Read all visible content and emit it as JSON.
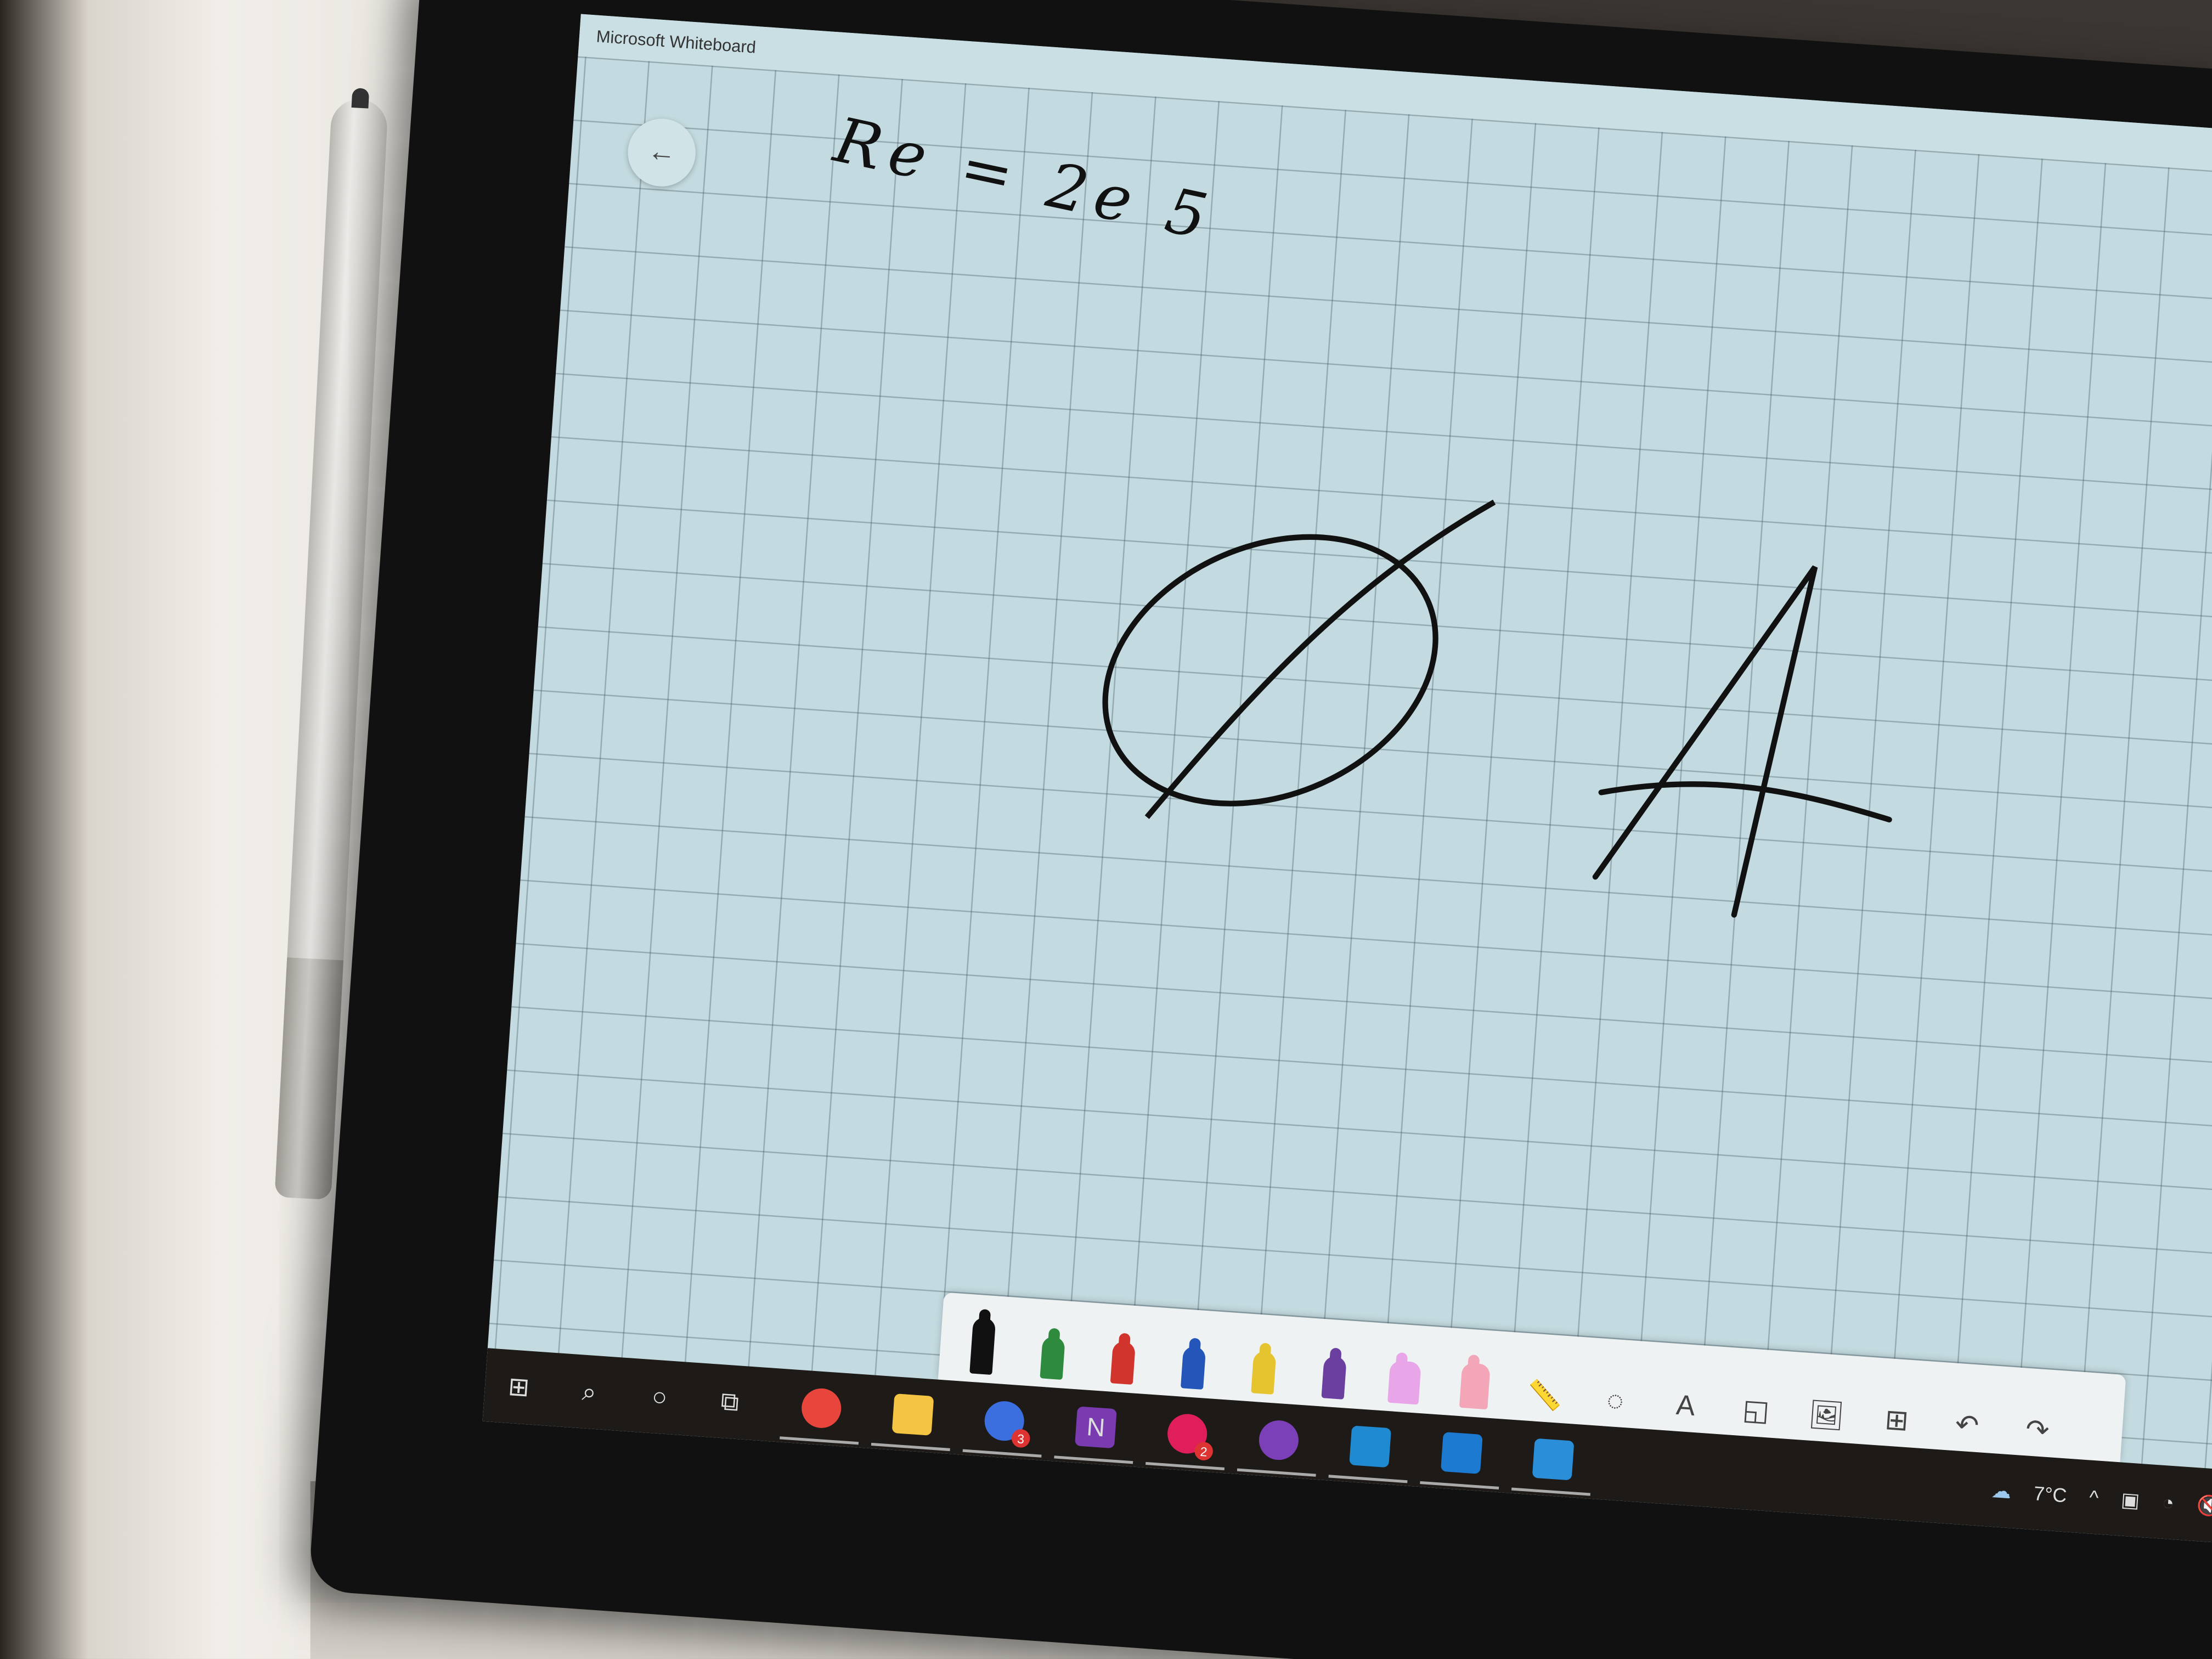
{
  "app": {
    "title": "Microsoft Whiteboard"
  },
  "canvas": {
    "ink_text": "Re = 2e 5",
    "ink_shapes": [
      "slashed-circle",
      "letter-A"
    ],
    "grid_color": "#c3dbe0"
  },
  "toolbar": {
    "tools": [
      {
        "name": "black-pen",
        "color": "#111111"
      },
      {
        "name": "green-pen",
        "color": "#2e8b3e"
      },
      {
        "name": "red-pen",
        "color": "#d0342c"
      },
      {
        "name": "blue-pen",
        "color": "#2455b8"
      },
      {
        "name": "yellow-pen",
        "color": "#e6c430"
      },
      {
        "name": "purple-pen",
        "color": "#6b3fa0"
      },
      {
        "name": "highlighter",
        "color": "#e8a6e8"
      },
      {
        "name": "eraser",
        "color": "#f2a6b8"
      }
    ],
    "text_tool_label": "A"
  },
  "taskbar": {
    "apps": [
      {
        "name": "chrome",
        "color": "#e8453c"
      },
      {
        "name": "file-explorer",
        "color": "#f4c542"
      },
      {
        "name": "discord",
        "color": "#3b6fe0",
        "badge": "3"
      },
      {
        "name": "onenote",
        "color": "#7a3bb0",
        "label": "N"
      },
      {
        "name": "slack",
        "color": "#e01e5a",
        "badge": "2"
      },
      {
        "name": "github-desktop",
        "color": "#7b3fb8"
      },
      {
        "name": "vscode",
        "color": "#1f8ad2"
      },
      {
        "name": "whiteboard",
        "color": "#1c7bd0"
      },
      {
        "name": "outlook",
        "color": "#2a8fd8"
      }
    ],
    "weather": "7°C"
  }
}
